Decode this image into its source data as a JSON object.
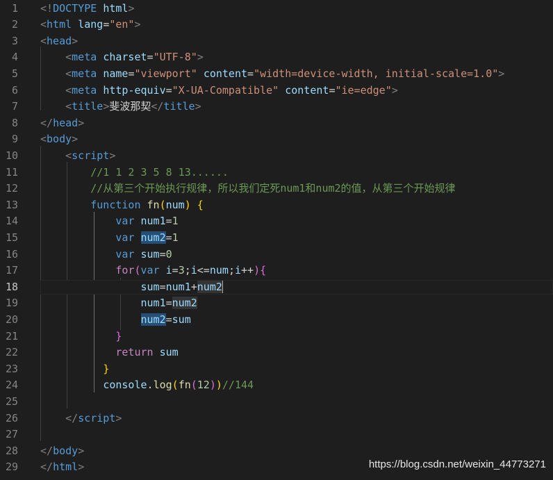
{
  "editor": {
    "active_line": 18,
    "lines": [
      {
        "n": "1",
        "t": [
          [
            "t-punct",
            "<!"
          ],
          [
            "t-tag",
            "DOCTYPE"
          ],
          [
            "t-text",
            " "
          ],
          [
            "t-attr",
            "html"
          ],
          [
            "t-punct",
            ">"
          ]
        ]
      },
      {
        "n": "2",
        "t": [
          [
            "t-punct",
            "<"
          ],
          [
            "t-tag",
            "html"
          ],
          [
            "t-text",
            " "
          ],
          [
            "t-attr",
            "lang"
          ],
          [
            "t-text",
            "="
          ],
          [
            "t-str",
            "\"en\""
          ],
          [
            "t-punct",
            ">"
          ]
        ]
      },
      {
        "n": "3",
        "t": [
          [
            "t-punct",
            "<"
          ],
          [
            "t-tag",
            "head"
          ],
          [
            "t-punct",
            ">"
          ]
        ]
      },
      {
        "n": "4",
        "t": [
          [
            "t-text",
            "    "
          ],
          [
            "t-punct",
            "<"
          ],
          [
            "t-tag",
            "meta"
          ],
          [
            "t-text",
            " "
          ],
          [
            "t-attr",
            "charset"
          ],
          [
            "t-text",
            "="
          ],
          [
            "t-str",
            "\"UTF-8\""
          ],
          [
            "t-punct",
            ">"
          ]
        ]
      },
      {
        "n": "5",
        "t": [
          [
            "t-text",
            "    "
          ],
          [
            "t-punct",
            "<"
          ],
          [
            "t-tag",
            "meta"
          ],
          [
            "t-text",
            " "
          ],
          [
            "t-attr",
            "name"
          ],
          [
            "t-text",
            "="
          ],
          [
            "t-str",
            "\"viewport\""
          ],
          [
            "t-text",
            " "
          ],
          [
            "t-attr",
            "content"
          ],
          [
            "t-text",
            "="
          ],
          [
            "t-str",
            "\"width=device-width, initial-scale=1.0\""
          ],
          [
            "t-punct",
            ">"
          ]
        ]
      },
      {
        "n": "6",
        "t": [
          [
            "t-text",
            "    "
          ],
          [
            "t-punct",
            "<"
          ],
          [
            "t-tag",
            "meta"
          ],
          [
            "t-text",
            " "
          ],
          [
            "t-attr",
            "http-equiv"
          ],
          [
            "t-text",
            "="
          ],
          [
            "t-str",
            "\"X-UA-Compatible\""
          ],
          [
            "t-text",
            " "
          ],
          [
            "t-attr",
            "content"
          ],
          [
            "t-text",
            "="
          ],
          [
            "t-str",
            "\"ie=edge\""
          ],
          [
            "t-punct",
            ">"
          ]
        ]
      },
      {
        "n": "7",
        "t": [
          [
            "t-text",
            "    "
          ],
          [
            "t-punct",
            "<"
          ],
          [
            "t-tag",
            "title"
          ],
          [
            "t-punct",
            ">"
          ],
          [
            "t-text",
            "斐波那契"
          ],
          [
            "t-punct",
            "</"
          ],
          [
            "t-tag",
            "title"
          ],
          [
            "t-punct",
            ">"
          ]
        ]
      },
      {
        "n": "8",
        "t": [
          [
            "t-punct",
            "</"
          ],
          [
            "t-tag",
            "head"
          ],
          [
            "t-punct",
            ">"
          ]
        ]
      },
      {
        "n": "9",
        "t": [
          [
            "t-punct",
            "<"
          ],
          [
            "t-tag",
            "body"
          ],
          [
            "t-punct",
            ">"
          ]
        ]
      },
      {
        "n": "10",
        "t": [
          [
            "t-text",
            "    "
          ],
          [
            "t-punct",
            "<"
          ],
          [
            "t-tag",
            "script"
          ],
          [
            "t-punct",
            ">"
          ]
        ]
      },
      {
        "n": "11",
        "t": [
          [
            "t-text",
            "        "
          ],
          [
            "t-cmt",
            "//1 1 2 3 5 8 13......"
          ]
        ]
      },
      {
        "n": "12",
        "t": [
          [
            "t-text",
            "        "
          ],
          [
            "t-cmt",
            "//从第三个开始执行规律，所以我们定死num1和num2的值，从第三个开始规律"
          ]
        ]
      },
      {
        "n": "13",
        "t": [
          [
            "t-text",
            "        "
          ],
          [
            "t-kw",
            "function"
          ],
          [
            "t-text",
            " "
          ],
          [
            "t-fn",
            "fn"
          ],
          [
            "t-br1",
            "("
          ],
          [
            "t-var",
            "num"
          ],
          [
            "t-br1",
            ")"
          ],
          [
            "t-text",
            " "
          ],
          [
            "t-br1",
            "{"
          ]
        ]
      },
      {
        "n": "14",
        "t": [
          [
            "t-text",
            "            "
          ],
          [
            "t-kw",
            "var"
          ],
          [
            "t-text",
            " "
          ],
          [
            "t-var",
            "num1"
          ],
          [
            "t-op",
            "="
          ],
          [
            "t-num",
            "1"
          ]
        ]
      },
      {
        "n": "15",
        "t": [
          [
            "t-text",
            "            "
          ],
          [
            "t-kw",
            "var"
          ],
          [
            "t-text",
            " "
          ],
          [
            "t-var hl",
            "num2"
          ],
          [
            "t-op",
            "="
          ],
          [
            "t-num",
            "1"
          ]
        ]
      },
      {
        "n": "16",
        "t": [
          [
            "t-text",
            "            "
          ],
          [
            "t-kw",
            "var"
          ],
          [
            "t-text",
            " "
          ],
          [
            "t-var",
            "sum"
          ],
          [
            "t-op",
            "="
          ],
          [
            "t-num",
            "0"
          ]
        ]
      },
      {
        "n": "17",
        "t": [
          [
            "t-text",
            "            "
          ],
          [
            "t-ctrl",
            "for"
          ],
          [
            "t-br2",
            "("
          ],
          [
            "t-kw",
            "var"
          ],
          [
            "t-text",
            " "
          ],
          [
            "t-var",
            "i"
          ],
          [
            "t-op",
            "="
          ],
          [
            "t-num",
            "3"
          ],
          [
            "t-text",
            ";"
          ],
          [
            "t-var",
            "i"
          ],
          [
            "t-op",
            "<="
          ],
          [
            "t-var",
            "num"
          ],
          [
            "t-text",
            ";"
          ],
          [
            "t-var",
            "i"
          ],
          [
            "t-op",
            "++"
          ],
          [
            "t-br2",
            ")"
          ],
          [
            "t-br2",
            "{"
          ]
        ]
      },
      {
        "n": "18",
        "t": [
          [
            "t-text",
            "                "
          ],
          [
            "t-var",
            "sum"
          ],
          [
            "t-op",
            "="
          ],
          [
            "t-var",
            "num1"
          ],
          [
            "t-op",
            "+"
          ],
          [
            "t-var hl2",
            "num2"
          ],
          [
            "cursor",
            ""
          ]
        ]
      },
      {
        "n": "19",
        "t": [
          [
            "t-text",
            "                "
          ],
          [
            "t-var",
            "num1"
          ],
          [
            "t-op",
            "="
          ],
          [
            "t-var hl2",
            "num2"
          ]
        ]
      },
      {
        "n": "20",
        "t": [
          [
            "t-text",
            "                "
          ],
          [
            "t-var hl",
            "num2"
          ],
          [
            "t-op",
            "="
          ],
          [
            "t-var",
            "sum"
          ]
        ]
      },
      {
        "n": "21",
        "t": [
          [
            "t-text",
            "            "
          ],
          [
            "t-br2",
            "}"
          ]
        ]
      },
      {
        "n": "22",
        "t": [
          [
            "t-text",
            "            "
          ],
          [
            "t-ctrl",
            "return"
          ],
          [
            "t-text",
            " "
          ],
          [
            "t-var",
            "sum"
          ]
        ]
      },
      {
        "n": "23",
        "t": [
          [
            "t-text",
            "          "
          ],
          [
            "t-br1",
            "}"
          ]
        ]
      },
      {
        "n": "24",
        "t": [
          [
            "t-text",
            "          "
          ],
          [
            "t-var",
            "console"
          ],
          [
            "t-text",
            "."
          ],
          [
            "t-fn",
            "log"
          ],
          [
            "t-br1",
            "("
          ],
          [
            "t-fn",
            "fn"
          ],
          [
            "t-br2",
            "("
          ],
          [
            "t-num",
            "12"
          ],
          [
            "t-br2",
            ")"
          ],
          [
            "t-br1",
            ")"
          ],
          [
            "t-cmt",
            "//144"
          ]
        ]
      },
      {
        "n": "25",
        "t": []
      },
      {
        "n": "26",
        "t": [
          [
            "t-text",
            "    "
          ],
          [
            "t-punct",
            "</"
          ],
          [
            "t-tag",
            "script"
          ],
          [
            "t-punct",
            ">"
          ]
        ]
      },
      {
        "n": "27",
        "t": []
      },
      {
        "n": "28",
        "t": [
          [
            "t-punct",
            "</"
          ],
          [
            "t-tag",
            "body"
          ],
          [
            "t-punct",
            ">"
          ]
        ]
      },
      {
        "n": "29",
        "t": [
          [
            "t-punct",
            "</"
          ],
          [
            "t-tag",
            "html"
          ],
          [
            "t-punct",
            ">"
          ]
        ]
      }
    ]
  },
  "watermark": "https://blog.csdn.net/weixin_44773271"
}
